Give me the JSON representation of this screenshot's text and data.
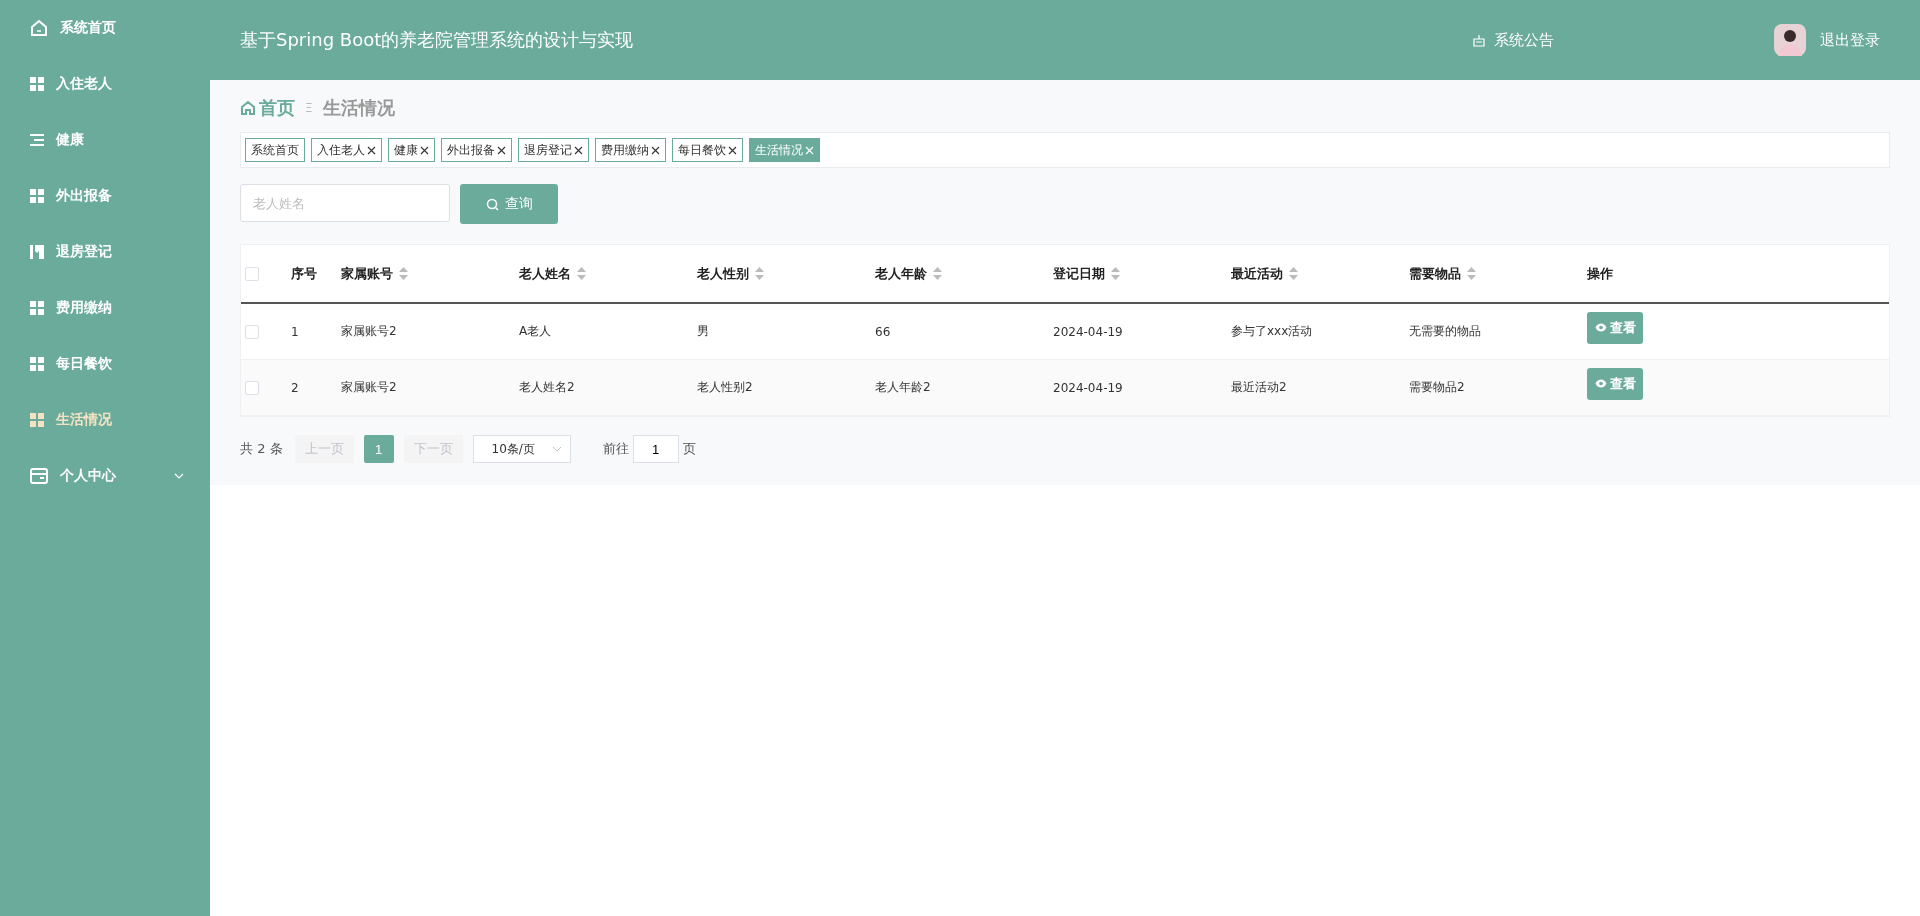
{
  "sidebar": {
    "items": [
      {
        "label": "系统首页",
        "kind": "home",
        "selected": false
      },
      {
        "label": "入住老人",
        "kind": "grid",
        "selected": false
      },
      {
        "label": "健康",
        "kind": "list",
        "selected": false
      },
      {
        "label": "外出报备",
        "kind": "grid",
        "selected": false
      },
      {
        "label": "退房登记",
        "kind": "book",
        "selected": false
      },
      {
        "label": "费用缴纳",
        "kind": "grid",
        "selected": false
      },
      {
        "label": "每日餐饮",
        "kind": "grid",
        "selected": false
      },
      {
        "label": "生活情况",
        "kind": "grid",
        "selected": true
      },
      {
        "label": "个人中心",
        "kind": "card",
        "selected": false,
        "expanded": false
      }
    ]
  },
  "header": {
    "title": "基于Spring Boot的养老院管理系统的设计与实现",
    "notice": "系统公告",
    "logout": "退出登录"
  },
  "breadcrumb": {
    "home": "首页",
    "separator": "Ξ",
    "current": "生活情况"
  },
  "tabs": [
    {
      "label": "系统首页",
      "selected": false,
      "closable": false
    },
    {
      "label": "入住老人",
      "selected": false,
      "closable": true
    },
    {
      "label": "健康",
      "selected": false,
      "closable": true
    },
    {
      "label": "外出报备",
      "selected": false,
      "closable": true
    },
    {
      "label": "退房登记",
      "selected": false,
      "closable": true
    },
    {
      "label": "费用缴纳",
      "selected": false,
      "closable": true
    },
    {
      "label": "每日餐饮",
      "selected": false,
      "closable": true
    },
    {
      "label": "生活情况",
      "selected": true,
      "closable": true
    }
  ],
  "search": {
    "placeholder": "老人姓名",
    "button": "查询"
  },
  "table": {
    "all_checked": false,
    "columns": [
      {
        "label": "序号",
        "sortable": false
      },
      {
        "label": "家属账号",
        "sortable": true
      },
      {
        "label": "老人姓名",
        "sortable": true
      },
      {
        "label": "老人性别",
        "sortable": true
      },
      {
        "label": "老人年龄",
        "sortable": true
      },
      {
        "label": "登记日期",
        "sortable": true
      },
      {
        "label": "最近活动",
        "sortable": true
      },
      {
        "label": "需要物品",
        "sortable": true
      },
      {
        "label": "操作",
        "sortable": false
      }
    ],
    "rows": [
      {
        "checked": false,
        "cells": [
          "1",
          "家属账号2",
          "A老人",
          "男",
          "66",
          "2024-04-19",
          "参与了xxx活动",
          "无需要的物品"
        ],
        "action": "查看"
      },
      {
        "checked": false,
        "cells": [
          "2",
          "家属账号2",
          "老人姓名2",
          "老人性别2",
          "老人年龄2",
          "2024-04-19",
          "最近活动2",
          "需要物品2"
        ],
        "action": "查看"
      }
    ]
  },
  "pagination": {
    "total": "共 2 条",
    "prev": "上一页",
    "pages": [
      {
        "label": "1",
        "selected": true
      }
    ],
    "next": "下一页",
    "page_size": "10条/页",
    "goto": "前往",
    "goto_value": "1",
    "page_unit": "页"
  }
}
